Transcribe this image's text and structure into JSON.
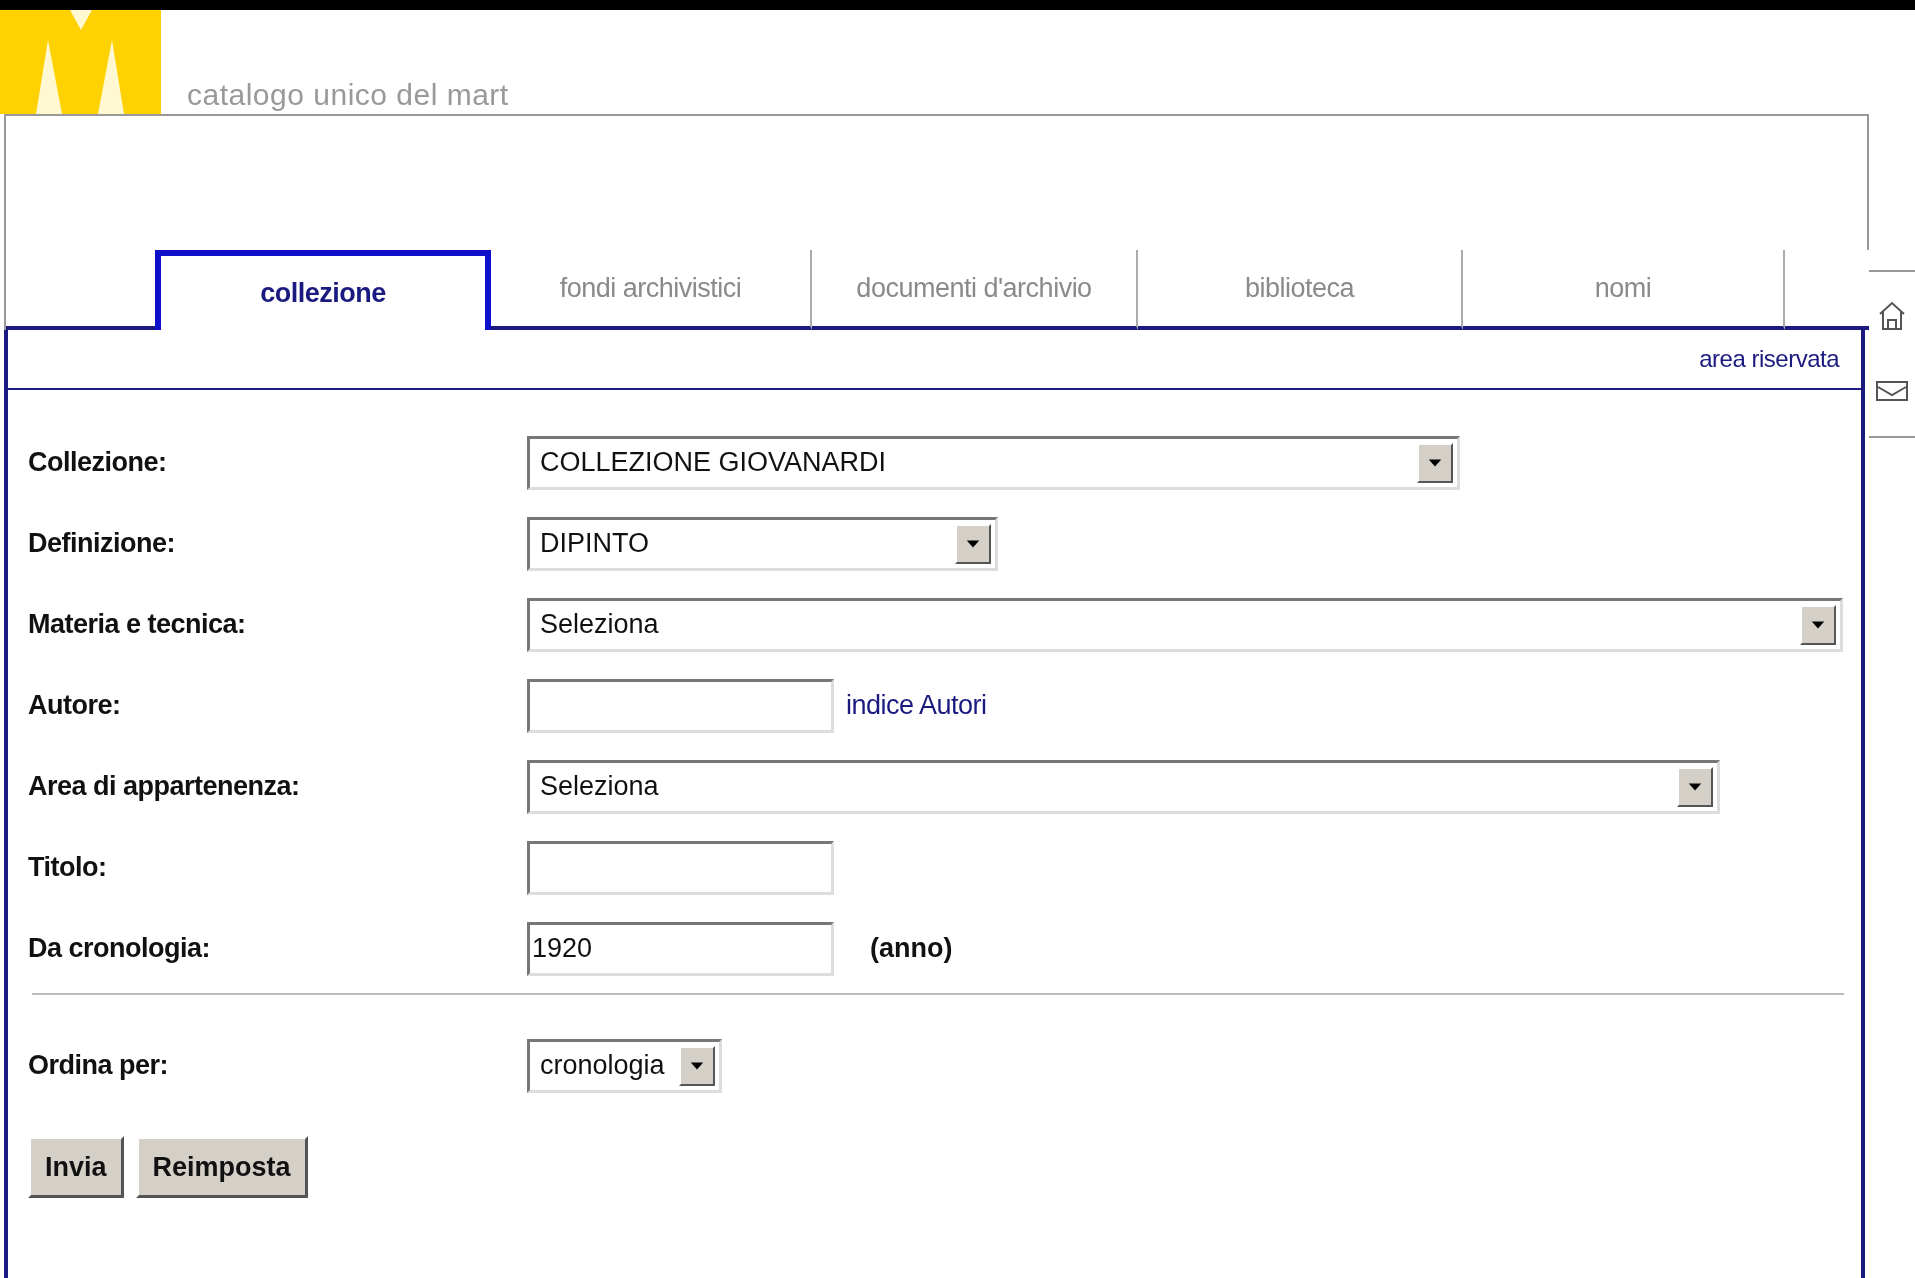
{
  "site_title": "catalogo unico del mart",
  "tabs": [
    {
      "label": "collezione",
      "selected": true
    },
    {
      "label": "fondi archivistici",
      "selected": false
    },
    {
      "label": "documenti d'archivio",
      "selected": false
    },
    {
      "label": "biblioteca",
      "selected": false
    },
    {
      "label": "nomi",
      "selected": false
    }
  ],
  "reserved_link": "area riservata",
  "fields": [
    {
      "label": "Collezione:",
      "kind": "select",
      "value": "COLLEZIONE GIOVANARDI"
    },
    {
      "label": "Definizione:",
      "kind": "select",
      "value": "DIPINTO"
    },
    {
      "label": "Materia e tecnica:",
      "kind": "select",
      "value": "Seleziona"
    },
    {
      "label": "Autore:",
      "kind": "text",
      "link": "indice Autori"
    },
    {
      "label": "Area di appartenenza:",
      "kind": "select",
      "value": "Seleziona"
    },
    {
      "label": "Titolo:",
      "kind": "text"
    },
    {
      "label": "Da cronologia:",
      "kind": "text",
      "value": "1920",
      "suffix": "(anno)"
    }
  ],
  "sort": {
    "label": "Ordina per:",
    "kind": "select",
    "value": "cronologia"
  },
  "buttons": [
    "Invia",
    "Reimposta"
  ]
}
